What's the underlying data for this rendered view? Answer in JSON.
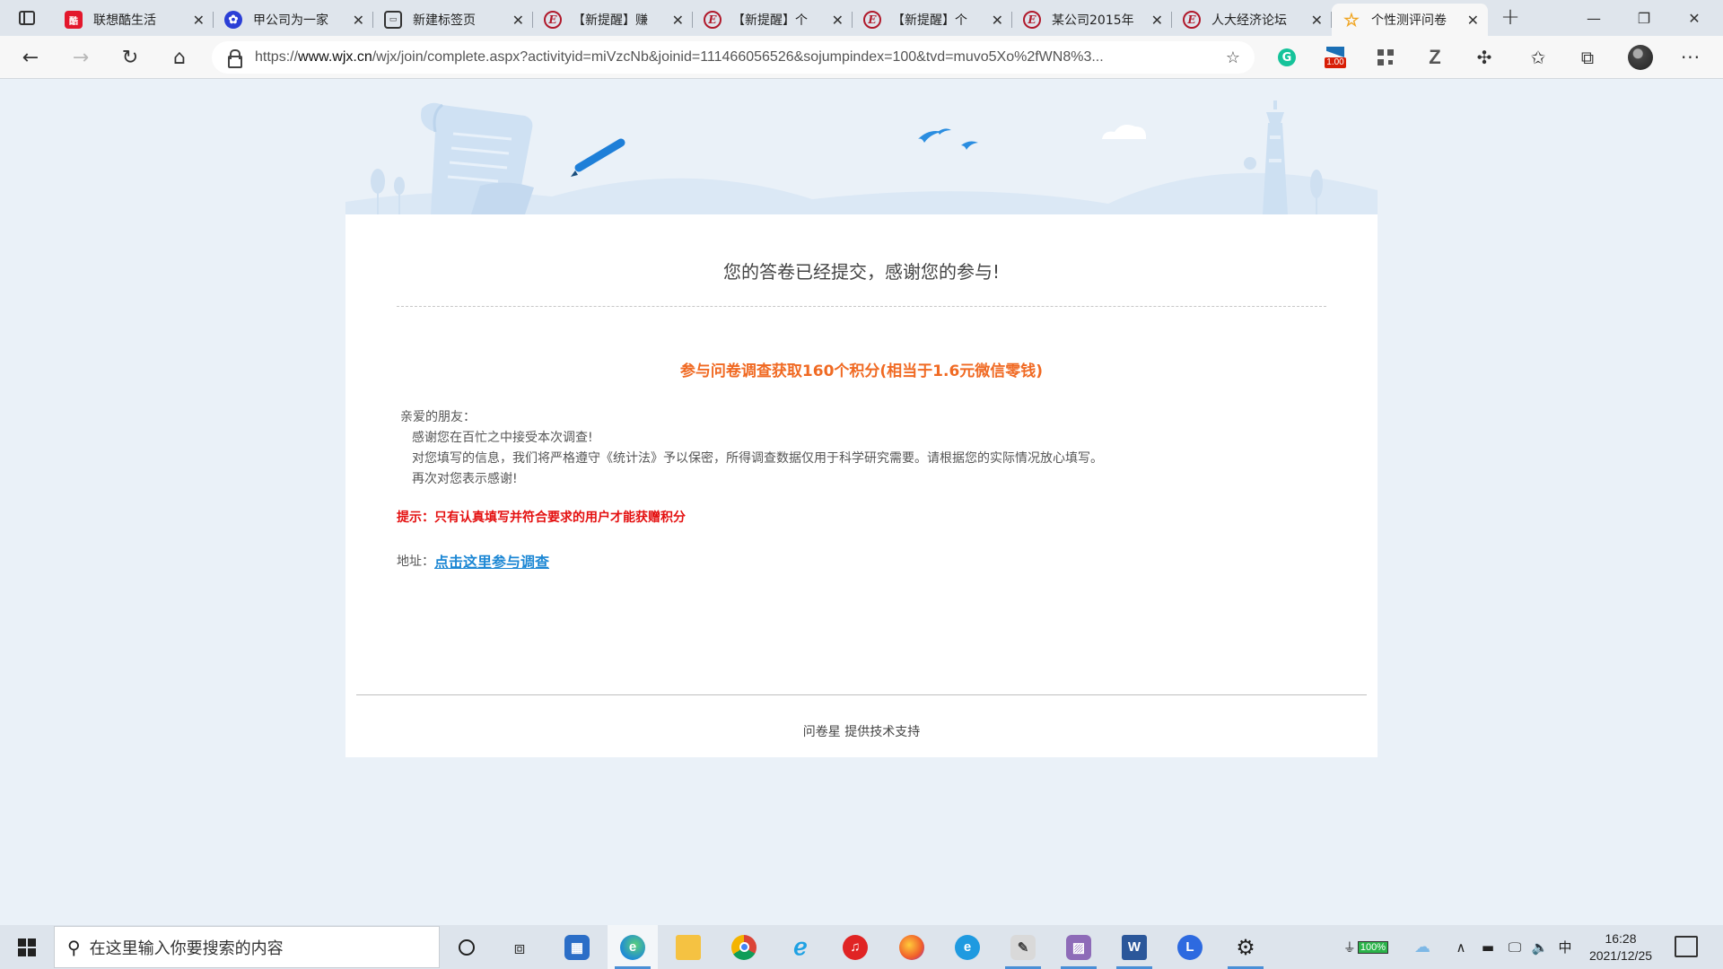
{
  "browser": {
    "tabs": [
      {
        "title": "联想酷生活",
        "favicon": "lenovo-icon",
        "favicon_text": "酷"
      },
      {
        "title": "甲公司为一家",
        "favicon": "baidu-paw-icon",
        "favicon_text": "✿"
      },
      {
        "title": "新建标签页",
        "favicon": "new-tab-icon",
        "favicon_text": "▭"
      },
      {
        "title": "【新提醒】赚",
        "favicon": "e-icon",
        "favicon_text": "E"
      },
      {
        "title": "【新提醒】个",
        "favicon": "e-icon",
        "favicon_text": "E"
      },
      {
        "title": "【新提醒】个",
        "favicon": "e-icon",
        "favicon_text": "E"
      },
      {
        "title": "某公司2015年",
        "favicon": "e-icon",
        "favicon_text": "E"
      },
      {
        "title": "人大经济论坛",
        "favicon": "e-icon",
        "favicon_text": "E"
      },
      {
        "title": "个性测评问卷",
        "favicon": "star-icon",
        "favicon_text": "☆",
        "active": true
      }
    ],
    "url_prefix": "https://",
    "url_host": "www.wjx.cn",
    "url_rest": "/wjx/join/complete.aspx?activityid=miVzcNb&joinid=111466056526&sojumpindex=100&tvd=muvo5Xo%2fWN8%3...",
    "extensions": {
      "grammarly_label": "G",
      "tamper_badge": "1.00",
      "z_label": "Z"
    }
  },
  "page": {
    "complete_title": "您的答卷已经提交，感谢您的参与!",
    "reward_text": "参与问卷调查获取160个积分(相当于1.6元微信零钱)",
    "letter": {
      "greeting": "亲爱的朋友：",
      "line1": "感谢您在百忙之中接受本次调查!",
      "line2": "对您填写的信息，我们将严格遵守《统计法》予以保密，所得调查数据仅用于科学研究需要。请根据您的实际情况放心填写。",
      "line3": "再次对您表示感谢!"
    },
    "tip_text": "提示：只有认真填写并符合要求的用户才能获赠积分",
    "address_label": "地址：",
    "survey_link": "点击这里参与调查",
    "footer_text": "问卷星 提供技术支持"
  },
  "taskbar": {
    "search_placeholder": "在这里输入你要搜索的内容",
    "battery_label": "100%",
    "ime_label": "中",
    "time": "16:28",
    "date": "2021/12/25"
  },
  "colors": {
    "accent_orange": "#f06a23",
    "tip_red": "#e41010",
    "link_blue": "#1c87d4",
    "page_bg": "#eaf1f8"
  }
}
